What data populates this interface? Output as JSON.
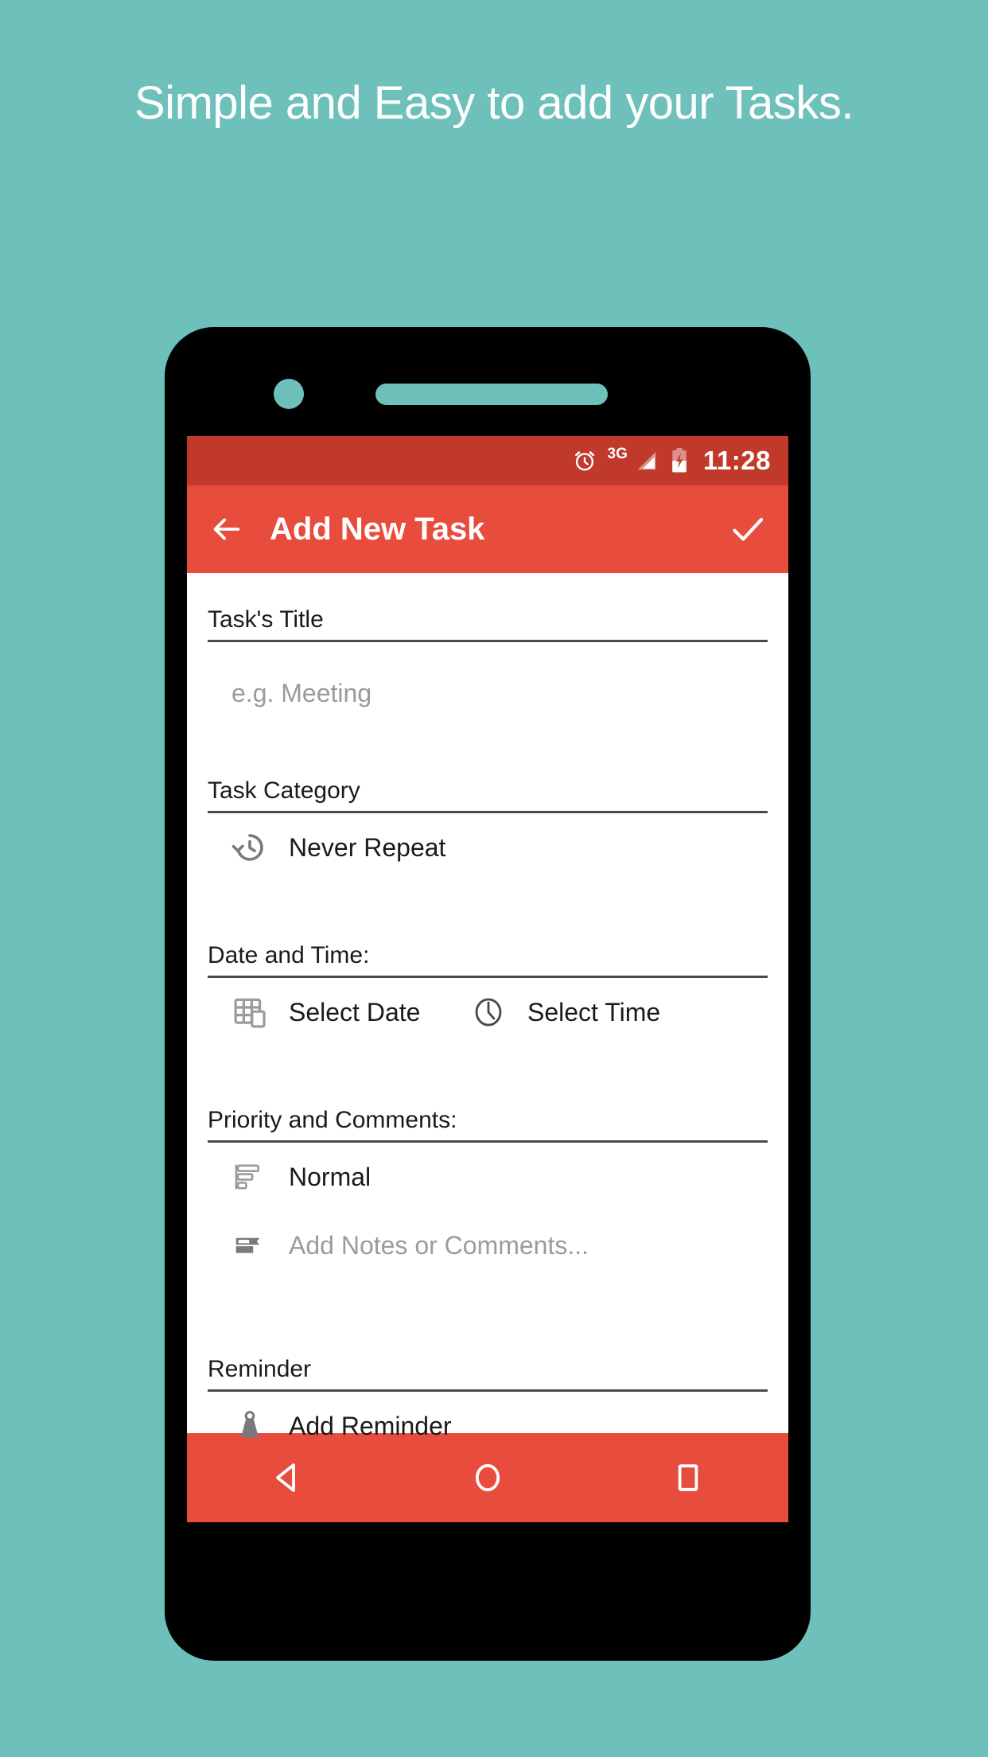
{
  "promo": {
    "headline": "Simple and Easy to add your Tasks."
  },
  "colors": {
    "background": "#6ec0ba",
    "accent": "#e74c3c",
    "statusbar": "#c0392b",
    "screen": "#ffffff",
    "text": "#1a1a1a",
    "placeholder": "#9b9b9b",
    "icon_gray": "#7a7a7a"
  },
  "status_bar": {
    "alarm_icon": "alarm-clock-icon",
    "network": "3G",
    "signal_icon": "signal-bars-icon",
    "battery_icon": "battery-charging-icon",
    "time": "11:28"
  },
  "app_bar": {
    "back_icon": "back-arrow-icon",
    "title": "Add New Task",
    "confirm_icon": "check-icon"
  },
  "form": {
    "sections": [
      {
        "label": "Task's Title",
        "field_type": "text-input",
        "value": "",
        "placeholder": "e.g. Meeting"
      },
      {
        "label": "Task Category",
        "field_type": "row",
        "icon": "history-repeat-icon",
        "value": "Never Repeat"
      },
      {
        "label": "Date and Time:",
        "field_type": "two-column",
        "date_icon": "calendar-icon",
        "date_value": "Select Date",
        "time_icon": "clock-icon",
        "time_value": "Select Time"
      },
      {
        "label": "Priority and Comments:",
        "field_type": "rows",
        "priority_icon": "priority-lines-icon",
        "priority_value": "Normal",
        "notes_icon": "notes-icon",
        "notes_placeholder": "Add Notes or Comments..."
      },
      {
        "label": "Reminder",
        "field_type": "row",
        "icon": "bell-reminder-icon",
        "value": "Add Reminder"
      }
    ]
  },
  "nav_bar": {
    "back": "nav-back-triangle-icon",
    "home": "nav-home-circle-icon",
    "recents": "nav-recents-square-icon"
  }
}
